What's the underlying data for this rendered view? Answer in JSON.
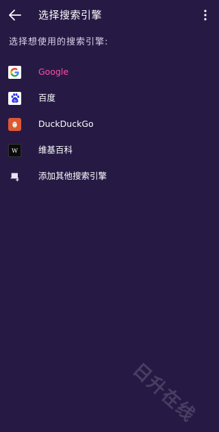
{
  "header": {
    "title": "选择搜索引擎"
  },
  "prompt": "选择想使用的搜索引擎:",
  "engines": [
    {
      "label": "Google",
      "icon": "google-logo-icon",
      "selected": true
    },
    {
      "label": "百度",
      "icon": "baidu-paw-icon",
      "selected": false
    },
    {
      "label": "DuckDuckGo",
      "icon": "duckduckgo-icon",
      "selected": false
    },
    {
      "label": "维基百科",
      "icon": "wikipedia-w-icon",
      "selected": false
    }
  ],
  "add_engine": {
    "label": "添加其他搜索引擎",
    "icon": "add-search-engine-icon"
  },
  "watermark": "日升在线",
  "colors": {
    "background": "#261a45",
    "accent": "#ff4fa3",
    "text": "#ffffff"
  }
}
